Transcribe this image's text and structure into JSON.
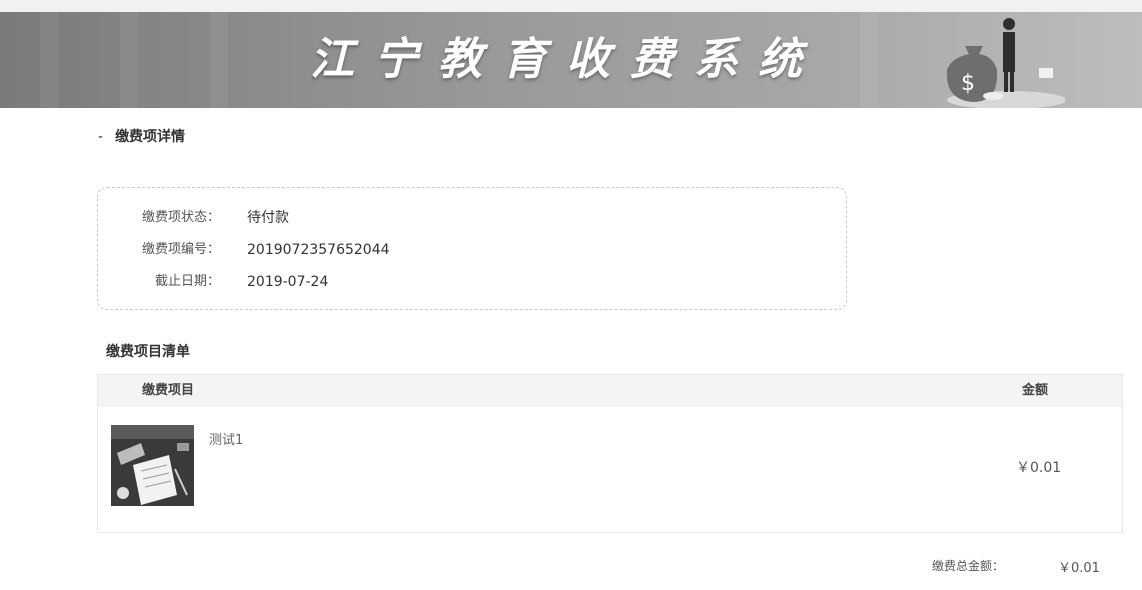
{
  "header": {
    "title": "江宁教育收费系统",
    "logo_icon": "money-bag-businessman-illustration"
  },
  "detail": {
    "section_title": "缴费项详情",
    "section_marker": "-",
    "status_label": "缴费项状态：",
    "status_value": "待付款",
    "number_label": "缴费项编号：",
    "number_value": "2019072357652044",
    "deadline_label": "截止日期：",
    "deadline_value": "2019-07-24"
  },
  "items": {
    "title": "缴费项目清单",
    "columns": [
      "缴费项目",
      "金额"
    ],
    "rows": [
      {
        "name": "测试1",
        "amount": "￥0.01",
        "thumbnail_icon": "study-desk-photo"
      }
    ]
  },
  "summary": {
    "total_label": "缴费总金额：",
    "total_value": "￥0.01"
  }
}
